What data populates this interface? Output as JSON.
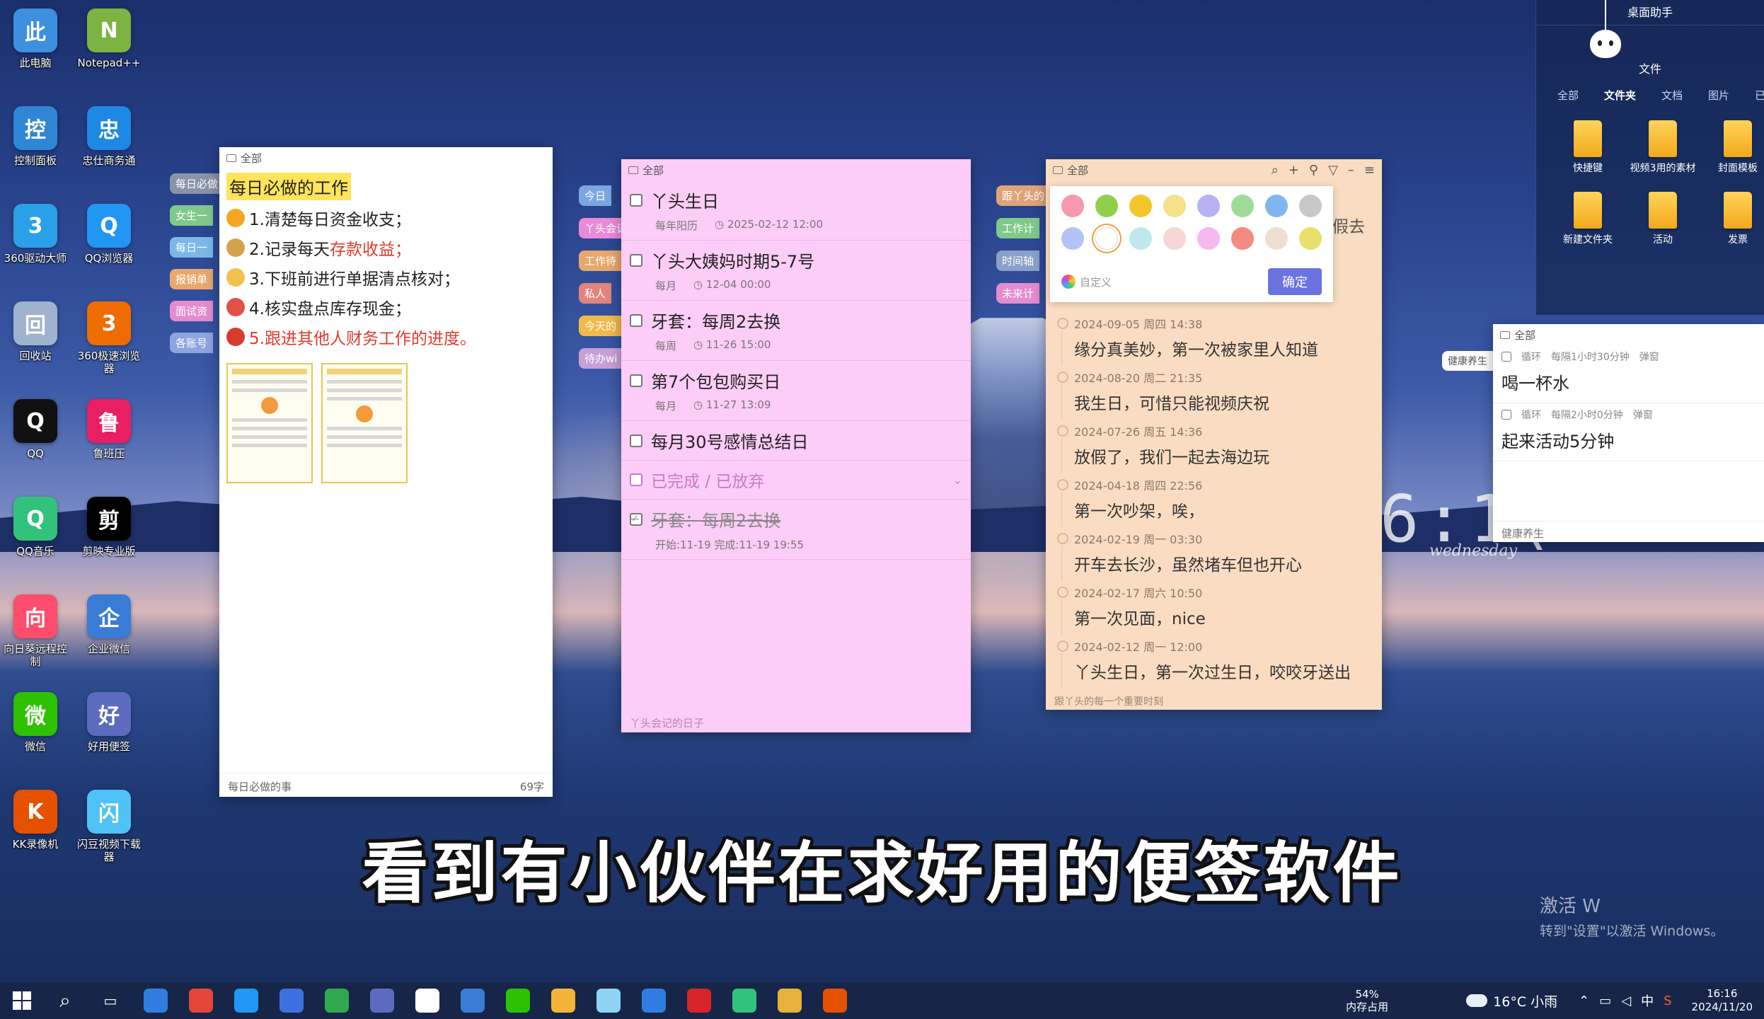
{
  "desktop_icons": [
    {
      "label": "此电脑",
      "icon": "computer-icon",
      "color": "#3d8fe0"
    },
    {
      "label": "Notepad++",
      "icon": "notepad-icon",
      "color": "#7cb342"
    },
    {
      "label": "控制面板",
      "icon": "control-panel-icon",
      "color": "#2f86d6"
    },
    {
      "label": "忠仕商务通",
      "icon": "app-r-icon",
      "color": "#1e88e5"
    },
    {
      "label": "360驱动大师",
      "icon": "driver-icon",
      "color": "#2aa0e8"
    },
    {
      "label": "QQ浏览器",
      "icon": "qq-browser-icon",
      "color": "#2196f3"
    },
    {
      "label": "回收站",
      "icon": "recycle-bin-icon",
      "color": "#9fb3cf"
    },
    {
      "label": "360极速浏览器",
      "icon": "browser-360-icon",
      "color": "#ef6c00"
    },
    {
      "label": "QQ",
      "icon": "qq-icon",
      "color": "#111111"
    },
    {
      "label": "鲁班压",
      "icon": "luban-icon",
      "color": "#e91e63"
    },
    {
      "label": "QQ音乐",
      "icon": "qq-music-icon",
      "color": "#31c27c"
    },
    {
      "label": "剪映专业版",
      "icon": "capcut-icon",
      "color": "#000000"
    },
    {
      "label": "向日葵远程控制",
      "icon": "sunlogin-icon",
      "color": "#ff4d6d"
    },
    {
      "label": "企业微信",
      "icon": "wecom-icon",
      "color": "#3a7bd5"
    },
    {
      "label": "微信",
      "icon": "wechat-icon",
      "color": "#2dc100"
    },
    {
      "label": "好用便签",
      "icon": "sticky-note-icon",
      "color": "#5c6bc0"
    },
    {
      "label": "KK录像机",
      "icon": "kk-recorder-icon",
      "color": "#e65100"
    },
    {
      "label": "闪豆视频下载器",
      "icon": "video-downloader-icon",
      "color": "#4fc3f7"
    }
  ],
  "note1": {
    "header": "全部",
    "title": "每日必做的工作",
    "lines": [
      {
        "text": "1.清楚每日资金收支；",
        "red": "",
        "color": "#f5a623"
      },
      {
        "text": "2.记录每天",
        "red": "存款收益；",
        "color": "#d4a24c"
      },
      {
        "text": "3.下班前进行单据清点核对；",
        "red": "",
        "color": "#f2c14e"
      },
      {
        "text": "4.核实盘点库存现金；",
        "red": "",
        "color": "#e2504c"
      },
      {
        "text": "",
        "red": "5.跟进其他人财务工作的进度。",
        "color": "#d83b2e"
      }
    ],
    "footer_label": "每日必做的事",
    "footer_count": "69字",
    "side_tabs": [
      {
        "label": "每日必做",
        "color": "#8a94a8"
      },
      {
        "label": "女生一",
        "color": "#7fc98a"
      },
      {
        "label": "每日一",
        "color": "#7bb8e8"
      },
      {
        "label": "报销单",
        "color": "#e8a86b"
      },
      {
        "label": "面试资",
        "color": "#e58ccf"
      },
      {
        "label": "各账号",
        "color": "#8fa3e0"
      }
    ]
  },
  "note2": {
    "header": "全部",
    "todos": [
      {
        "title": "丫头生日",
        "repeat": "每年阳历",
        "time": "2025-02-12 12:00"
      },
      {
        "title": "丫头大姨妈时期5-7号",
        "repeat": "每月",
        "time": "12-04 00:00"
      },
      {
        "title": "牙套：每周2去换",
        "repeat": "每周",
        "time": "11-26 15:00"
      },
      {
        "title": "第7个包包购买日",
        "repeat": "每月",
        "time": "11-27 13:09"
      },
      {
        "title": "每月30号感情总结日",
        "repeat": "",
        "time": ""
      }
    ],
    "done_header": "已完成 / 已放弃",
    "done_items": [
      {
        "title": "牙套：每周2去换",
        "detail": "开始:11-19  完成:11-19 19:55"
      }
    ],
    "footer": "丫头会记的日子",
    "side_tabs": [
      {
        "label": "今日",
        "color": "#7aa7e0"
      },
      {
        "label": "丫头会记",
        "color": "#e98bd6"
      },
      {
        "label": "工作待",
        "color": "#e8a86b"
      },
      {
        "label": "私人",
        "color": "#e2847c"
      },
      {
        "label": "今天的",
        "color": "#f2b94a"
      },
      {
        "label": "待办wi",
        "color": "#c7a0d8"
      }
    ]
  },
  "note3": {
    "header": "全部",
    "palette_colors": [
      "#f598b0",
      "#8fcf4a",
      "#f5c52c",
      "#f6e08a",
      "#b8b2f2",
      "#9fdc9a",
      "#7fb6f2",
      "#c8c8c8",
      "#b4c3f5",
      "#ffffff",
      "#bfe8ee",
      "#f7d6d6",
      "#f6b8f0",
      "#f58a82",
      "#eedfcf",
      "#e8e06a"
    ],
    "custom_label": "自定义",
    "confirm_label": "确定",
    "peek_text": "假去",
    "entries": [
      {
        "date": "2024-09-05 周四 14:38",
        "text": "缘分真美妙，第一次被家里人知道"
      },
      {
        "date": "2024-08-20 周二 21:35",
        "text": "我生日，可惜只能视频庆祝"
      },
      {
        "date": "2024-07-26 周五 14:36",
        "text": "放假了，我们一起去海边玩"
      },
      {
        "date": "2024-04-18 周四 22:56",
        "text": "第一次吵架，唉，"
      },
      {
        "date": "2024-02-19 周一 03:30",
        "text": "开车去长沙，虽然堵车但也开心"
      },
      {
        "date": "2024-02-17 周六 10:50",
        "text": "第一次见面，nice"
      },
      {
        "date": "2024-02-12 周一 12:00",
        "text": "丫头生日，第一次过生日，咬咬牙送出"
      }
    ],
    "footer": "跟丫头的每一个重要时刻",
    "side_tabs": [
      {
        "label": "跟丫头的",
        "color": "#e0a47a"
      },
      {
        "label": "工作计",
        "color": "#7fc98a"
      },
      {
        "label": "时间轴",
        "color": "#8aa0c8"
      },
      {
        "label": "未来计",
        "color": "#e58ccf"
      }
    ]
  },
  "note4": {
    "header": "全部",
    "side_tab": "健康养生",
    "reminders": [
      {
        "type": "循环",
        "interval": "每隔1小时30分钟",
        "mode": "弹窗",
        "text": "喝一杯水"
      },
      {
        "type": "循环",
        "interval": "每隔2小时0分钟",
        "mode": "弹窗",
        "text": "起来活动5分钟"
      }
    ],
    "footer": "健康养生"
  },
  "assistant": {
    "title": "桌面助手",
    "section": "文件",
    "tabs": [
      "全部",
      "文件夹",
      "文档",
      "图片",
      "已"
    ],
    "active_tab": "文件夹",
    "folders": [
      "快捷键",
      "视频3用的素材",
      "封面模板",
      "新建文件夹",
      "活动",
      "发票"
    ]
  },
  "clock": {
    "time": "6:1(",
    "day": "wednesday"
  },
  "subtitle": "看到有小伙伴在求好用的便签软件",
  "activation": {
    "line1": "激活 W",
    "line2": "转到\"设置\"以激活 Windows。"
  },
  "taskbar": {
    "apps": [
      {
        "icon": "search-icon",
        "color": "#162548"
      },
      {
        "icon": "task-view-icon",
        "color": "#162548"
      },
      {
        "icon": "app-blue-icon",
        "color": "#2f7de1"
      },
      {
        "icon": "chrome-icon",
        "color": "#e2463b"
      },
      {
        "icon": "qq-browser-icon",
        "color": "#2196f3"
      },
      {
        "icon": "sogou-icon",
        "color": "#3d6fe0"
      },
      {
        "icon": "ie-green-icon",
        "color": "#2fa84f"
      },
      {
        "icon": "sticky-note-icon",
        "color": "#5c6bc0"
      },
      {
        "icon": "qq-icon",
        "color": "#ffffff"
      },
      {
        "icon": "wecom-icon",
        "color": "#3a7bd5"
      },
      {
        "icon": "wechat-icon",
        "color": "#2dc100"
      },
      {
        "icon": "explorer-icon",
        "color": "#f2b53a"
      },
      {
        "icon": "notes-icon",
        "color": "#8fd3f4"
      },
      {
        "icon": "app-blue-icon",
        "color": "#2f7de1"
      },
      {
        "icon": "wps-icon",
        "color": "#d8232a"
      },
      {
        "icon": "qq-music-icon",
        "color": "#31c27c"
      },
      {
        "icon": "app-yellow-icon",
        "color": "#e8b23a"
      },
      {
        "icon": "kk-recorder-icon",
        "color": "#e65100"
      }
    ],
    "memory_pct": "54%",
    "memory_label": "内存占用",
    "weather": "16°C 小雨",
    "ime": "中",
    "time": "16:16",
    "date": "2024/11/20"
  }
}
